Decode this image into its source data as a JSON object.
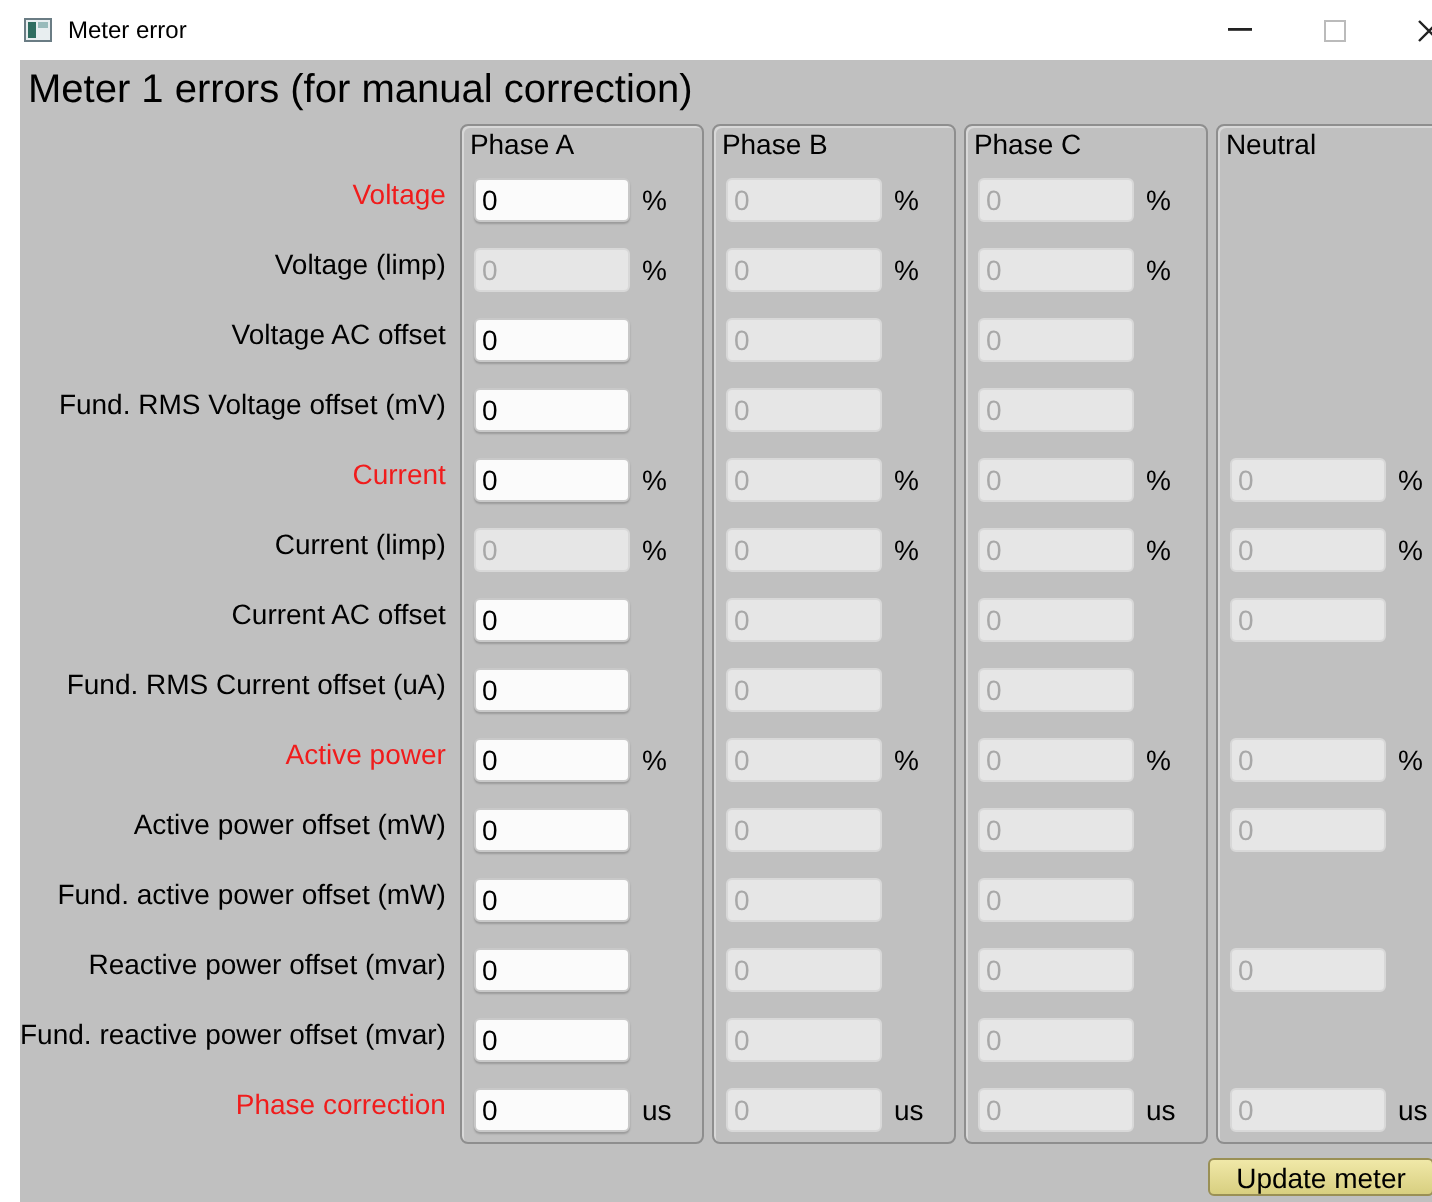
{
  "window": {
    "title": "Meter error"
  },
  "heading": "Meter 1 errors (for manual correction)",
  "rows": [
    {
      "label": "Voltage",
      "highlight": true
    },
    {
      "label": "Voltage (limp)",
      "highlight": false
    },
    {
      "label": "Voltage AC offset",
      "highlight": false
    },
    {
      "label": "Fund. RMS Voltage offset (mV)",
      "highlight": false
    },
    {
      "label": "Current",
      "highlight": true
    },
    {
      "label": "Current (limp)",
      "highlight": false
    },
    {
      "label": "Current AC offset",
      "highlight": false
    },
    {
      "label": "Fund. RMS Current offset (uA)",
      "highlight": false
    },
    {
      "label": "Active power",
      "highlight": true
    },
    {
      "label": "Active power offset (mW)",
      "highlight": false
    },
    {
      "label": "Fund. active power offset (mW)",
      "highlight": false
    },
    {
      "label": "Reactive power offset (mvar)",
      "highlight": false
    },
    {
      "label": "Fund. reactive power offset (mvar)",
      "highlight": false
    },
    {
      "label": "Phase correction",
      "highlight": true
    }
  ],
  "panels": [
    {
      "title": "Phase A",
      "cells": [
        {
          "kind": "field",
          "value": "0",
          "disabled": false,
          "unit": "%"
        },
        {
          "kind": "field",
          "value": "0",
          "disabled": true,
          "unit": "%"
        },
        {
          "kind": "field",
          "value": "0",
          "disabled": false
        },
        {
          "kind": "field",
          "value": "0",
          "disabled": false
        },
        {
          "kind": "field",
          "value": "0",
          "disabled": false,
          "unit": "%"
        },
        {
          "kind": "field",
          "value": "0",
          "disabled": true,
          "unit": "%"
        },
        {
          "kind": "field",
          "value": "0",
          "disabled": false
        },
        {
          "kind": "field",
          "value": "0",
          "disabled": false
        },
        {
          "kind": "field",
          "value": "0",
          "disabled": false,
          "unit": "%"
        },
        {
          "kind": "field",
          "value": "0",
          "disabled": false
        },
        {
          "kind": "field",
          "value": "0",
          "disabled": false
        },
        {
          "kind": "field",
          "value": "0",
          "disabled": false
        },
        {
          "kind": "field",
          "value": "0",
          "disabled": false
        },
        {
          "kind": "field",
          "value": "0",
          "disabled": false,
          "unit": "us"
        }
      ]
    },
    {
      "title": "Phase B",
      "cells": [
        {
          "kind": "field",
          "value": "0",
          "disabled": true,
          "unit": "%"
        },
        {
          "kind": "field",
          "value": "0",
          "disabled": true,
          "unit": "%"
        },
        {
          "kind": "field",
          "value": "0",
          "disabled": true
        },
        {
          "kind": "field",
          "value": "0",
          "disabled": true
        },
        {
          "kind": "field",
          "value": "0",
          "disabled": true,
          "unit": "%"
        },
        {
          "kind": "field",
          "value": "0",
          "disabled": true,
          "unit": "%"
        },
        {
          "kind": "field",
          "value": "0",
          "disabled": true
        },
        {
          "kind": "field",
          "value": "0",
          "disabled": true
        },
        {
          "kind": "field",
          "value": "0",
          "disabled": true,
          "unit": "%"
        },
        {
          "kind": "field",
          "value": "0",
          "disabled": true
        },
        {
          "kind": "field",
          "value": "0",
          "disabled": true
        },
        {
          "kind": "field",
          "value": "0",
          "disabled": true
        },
        {
          "kind": "field",
          "value": "0",
          "disabled": true
        },
        {
          "kind": "field",
          "value": "0",
          "disabled": true,
          "unit": "us"
        }
      ]
    },
    {
      "title": "Phase C",
      "cells": [
        {
          "kind": "field",
          "value": "0",
          "disabled": true,
          "unit": "%"
        },
        {
          "kind": "field",
          "value": "0",
          "disabled": true,
          "unit": "%"
        },
        {
          "kind": "field",
          "value": "0",
          "disabled": true
        },
        {
          "kind": "field",
          "value": "0",
          "disabled": true
        },
        {
          "kind": "field",
          "value": "0",
          "disabled": true,
          "unit": "%"
        },
        {
          "kind": "field",
          "value": "0",
          "disabled": true,
          "unit": "%"
        },
        {
          "kind": "field",
          "value": "0",
          "disabled": true
        },
        {
          "kind": "field",
          "value": "0",
          "disabled": true
        },
        {
          "kind": "field",
          "value": "0",
          "disabled": true,
          "unit": "%"
        },
        {
          "kind": "field",
          "value": "0",
          "disabled": true
        },
        {
          "kind": "field",
          "value": "0",
          "disabled": true
        },
        {
          "kind": "field",
          "value": "0",
          "disabled": true
        },
        {
          "kind": "field",
          "value": "0",
          "disabled": true
        },
        {
          "kind": "field",
          "value": "0",
          "disabled": true,
          "unit": "us"
        }
      ]
    },
    {
      "title": "Neutral",
      "cells": [
        {
          "kind": "empty"
        },
        {
          "kind": "empty"
        },
        {
          "kind": "empty"
        },
        {
          "kind": "empty"
        },
        {
          "kind": "field",
          "value": "0",
          "disabled": true,
          "unit": "%"
        },
        {
          "kind": "field",
          "value": "0",
          "disabled": true,
          "unit": "%"
        },
        {
          "kind": "field",
          "value": "0",
          "disabled": true
        },
        {
          "kind": "empty"
        },
        {
          "kind": "field",
          "value": "0",
          "disabled": true,
          "unit": "%"
        },
        {
          "kind": "field",
          "value": "0",
          "disabled": true
        },
        {
          "kind": "empty"
        },
        {
          "kind": "field",
          "value": "0",
          "disabled": true
        },
        {
          "kind": "empty"
        },
        {
          "kind": "field",
          "value": "0",
          "disabled": true,
          "unit": "us"
        }
      ]
    }
  ],
  "button": "Update meter"
}
